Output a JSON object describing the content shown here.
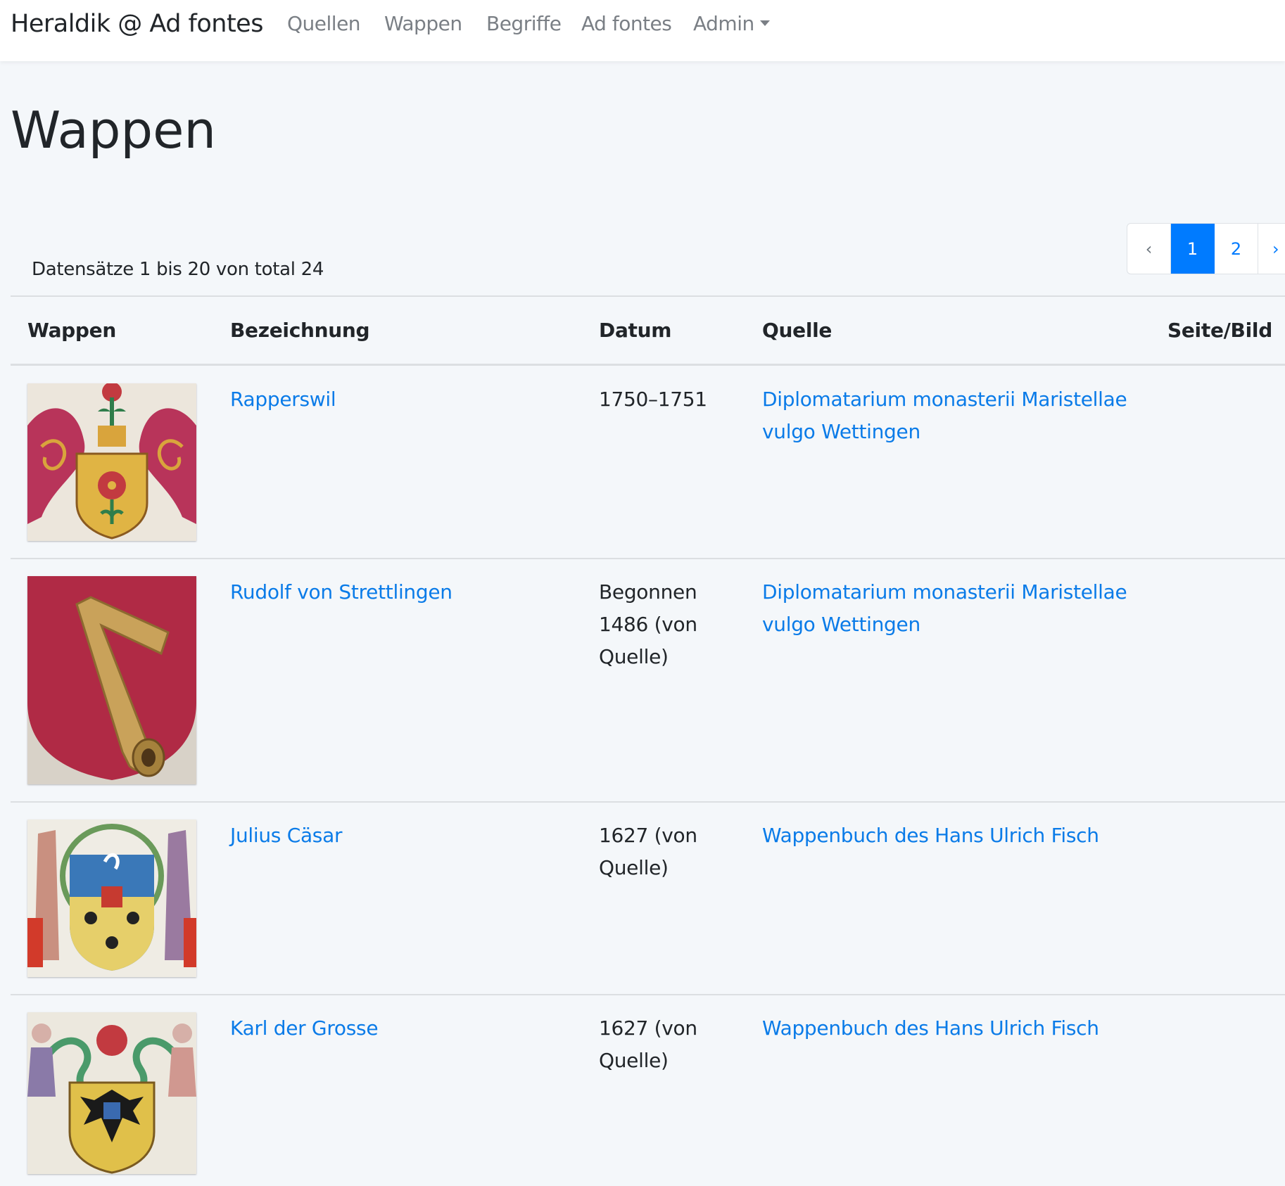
{
  "navbar": {
    "brand": "Heraldik @ Ad fontes",
    "items": [
      {
        "label": "Quellen"
      },
      {
        "label": "Wappen"
      },
      {
        "label": "Begriffe"
      },
      {
        "label": "Ad fontes"
      },
      {
        "label": "Admin"
      }
    ]
  },
  "page": {
    "title": "Wappen",
    "records_info": "Datensätze 1 bis 20 von total 24"
  },
  "pagination": {
    "prev": "‹",
    "pages": [
      "1",
      "2"
    ],
    "next": "›",
    "active_page": "1"
  },
  "table": {
    "headers": [
      "Wappen",
      "Bezeichnung",
      "Datum",
      "Quelle",
      "Seite/Bild"
    ],
    "rows": [
      {
        "name": "Rapperswil",
        "date": "1750–1751",
        "source": "Diplomatarium monasterii Maristellae vulgo Wettingen",
        "image_icon": "coat-of-arms-rose-icon"
      },
      {
        "name": "Rudolf von Strettlingen",
        "date": "Begonnen 1486 (von Quelle)",
        "source": "Diplomatarium monasterii Maristellae vulgo Wettingen",
        "image_icon": "coat-of-arms-horn-icon"
      },
      {
        "name": "Julius Cäsar",
        "date": "1627 (von Quelle)",
        "source": "Wappenbuch des Hans Ulrich Fisch",
        "image_icon": "coat-of-arms-supporters-icon"
      },
      {
        "name": "Karl der Grosse",
        "date": "1627 (von Quelle)",
        "source": "Wappenbuch des Hans Ulrich Fisch",
        "image_icon": "coat-of-arms-eagle-icon"
      }
    ]
  },
  "colors": {
    "link": "#0a7be8",
    "active_page": "#007bff",
    "background": "#f4f7fa"
  }
}
